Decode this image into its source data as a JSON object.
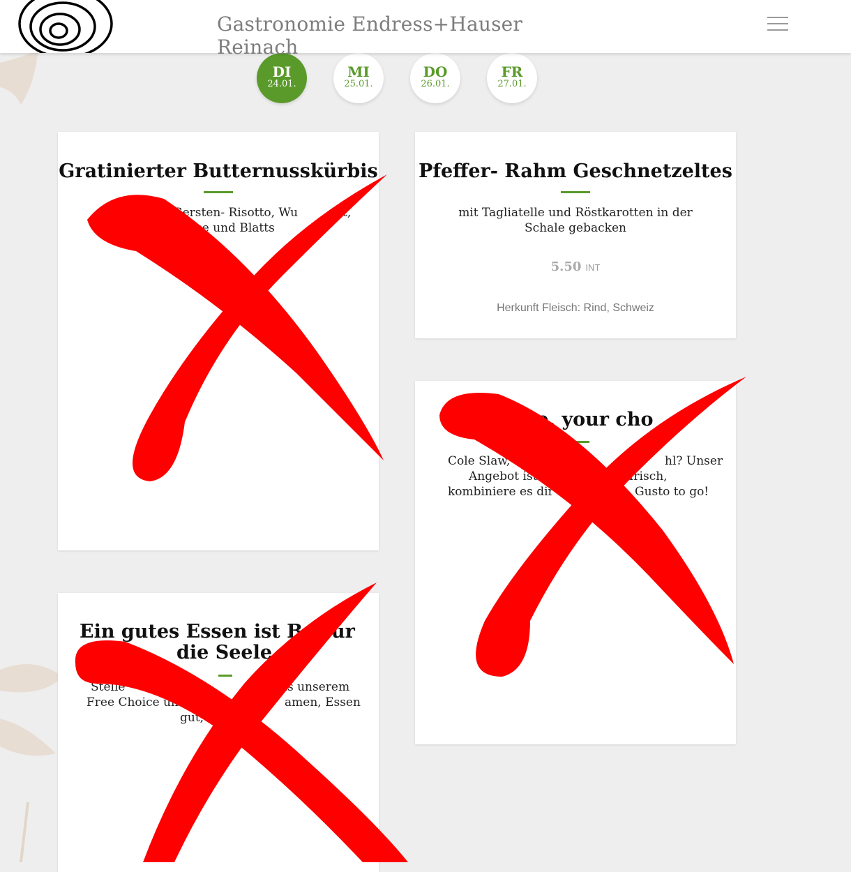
{
  "header": {
    "title": "Gastronomie Endress+Hauser Reinach"
  },
  "days": [
    {
      "day": "DI",
      "date": "24.01.",
      "active": true
    },
    {
      "day": "MI",
      "date": "25.01.",
      "active": false
    },
    {
      "day": "DO",
      "date": "26.01.",
      "active": false
    },
    {
      "day": "FR",
      "date": "27.01.",
      "active": false
    }
  ],
  "menus": {
    "butternut": {
      "title": "Gratinierter Butternusskürbis",
      "desc_line1": "Gersten- Risotto, Wu",
      "desc_line1b": "t,",
      "desc_line2": "se und Blatts"
    },
    "geschnetzeltes": {
      "title": "Pfeffer- Rahm Geschnetzeltes",
      "desc": "mit Tagliatelle und Röstkarotten in der Schale gebacken",
      "price": "5.50",
      "price_unit": "INT",
      "origin": "Herkunft Fleisch: Rind, Schweiz"
    },
    "choice": {
      "title_part": "te, your cho",
      "desc_line1a": "Cole Slaw, ",
      "desc_line1b": "hl? Unser",
      "desc_line2a": "Angebot ist ",
      "desc_line2b": "ktfrisch,",
      "desc_line3a": "kombiniere es dir ",
      "desc_line3b": "Gusto to go!"
    },
    "balsam": {
      "title_line1a": "Ein gutes Essen ist Bal",
      "title_line1b": "ür",
      "title_line2": "die Seele",
      "desc_line1a": "Stelle",
      "desc_line1b": "us unserem",
      "desc_line2a": "Free Choice und",
      "desc_line2b": "amen, Essen",
      "desc_line3a": "gut,"
    }
  },
  "colors": {
    "accent": "#5a9a2a",
    "cross": "#ff0000",
    "background": "#eeeeee"
  },
  "icons": {
    "menu": "hamburger-icon",
    "logo": "spiral-logo"
  }
}
